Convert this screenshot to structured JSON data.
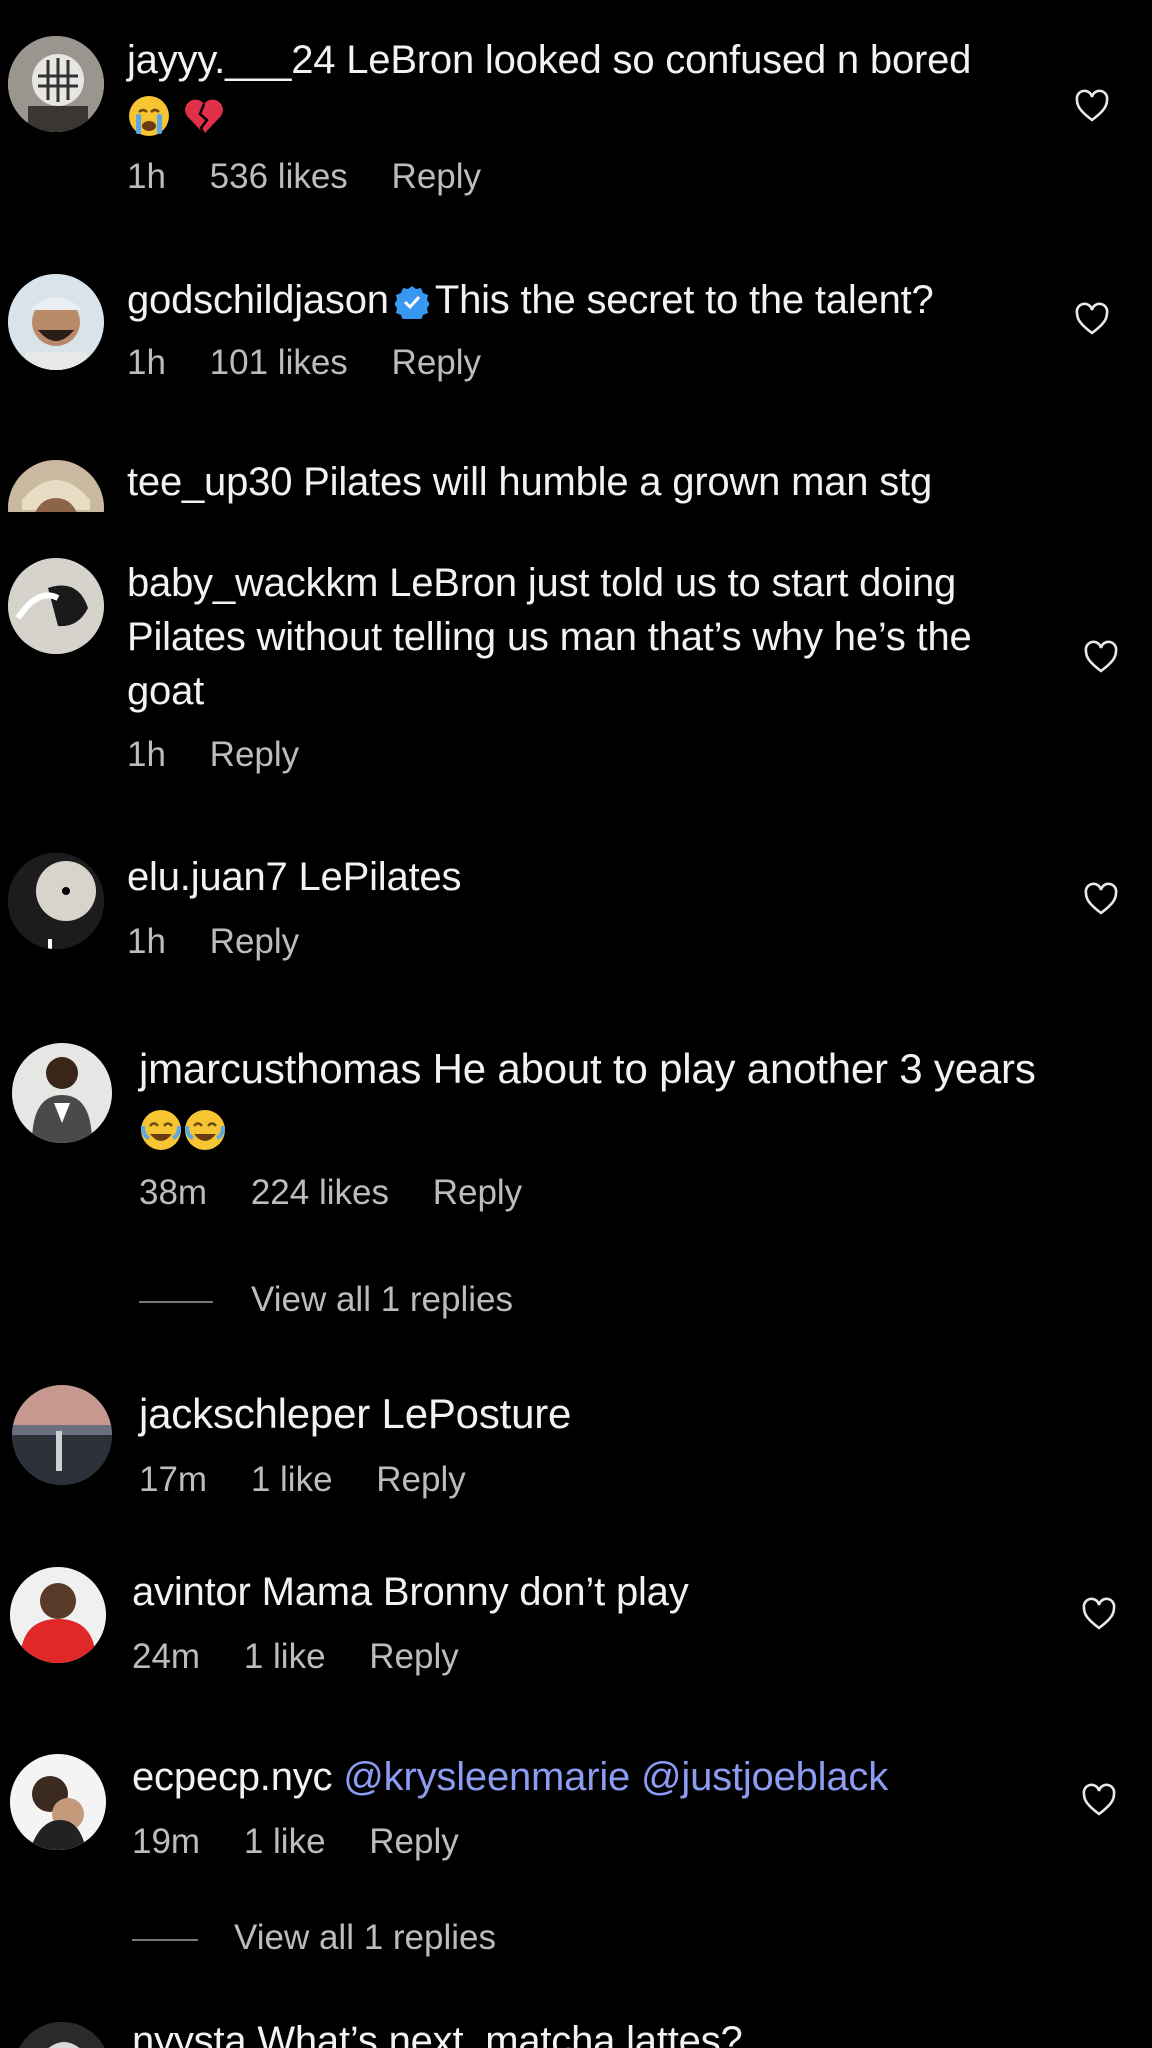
{
  "comments": [
    {
      "user": "jayyy.___24",
      "text": "LeBron looked so confused n bored",
      "time": "1h",
      "likes": "536 likes",
      "reply": "Reply"
    },
    {
      "user": "godschildjason",
      "text": "This the secret to the talent?",
      "time": "1h",
      "likes": "101 likes",
      "reply": "Reply"
    },
    {
      "user": "tee_up30",
      "text": "Pilates will humble a grown man stg"
    },
    {
      "user": "baby_wackkm",
      "text": "LeBron just told us to start doing Pilates without telling us man that’s why he’s the goat",
      "time": "1h",
      "reply": "Reply"
    },
    {
      "user": "elu.juan7",
      "text": "LePilates",
      "time": "1h",
      "reply": "Reply"
    },
    {
      "user": "jmarcusthomas",
      "text": "He about to play another 3 years",
      "time": "38m",
      "likes": "224 likes",
      "reply": "Reply",
      "view_replies": "View all 1 replies"
    },
    {
      "user": "jackschleper",
      "text": "LePosture",
      "time": "17m",
      "likes": "1 like",
      "reply": "Reply"
    },
    {
      "user": "avintor",
      "text": "Mama Bronny don’t play",
      "time": "24m",
      "likes": "1 like",
      "reply": "Reply"
    },
    {
      "user": "ecpecp.nyc",
      "mention1": "@krysleenmarie",
      "mention2": "@justjoeblack",
      "time": "19m",
      "likes": "1 like",
      "reply": "Reply",
      "view_replies": "View all 1 replies"
    },
    {
      "user": "nyysta",
      "text": "What’s next, matcha lattes?"
    }
  ],
  "icons": {
    "like": "heart-outline-icon",
    "verified": "verified-badge-icon",
    "emoji_crying": "loudly-crying-face-emoji",
    "emoji_broken_heart": "broken-heart-emoji",
    "emoji_laughing": "tears-of-joy-emoji"
  },
  "colors": {
    "background": "#000000",
    "text": "#f2f2f2",
    "meta": "#bcbcbc",
    "mention": "#8c9cf2",
    "verified": "#3897f0"
  }
}
